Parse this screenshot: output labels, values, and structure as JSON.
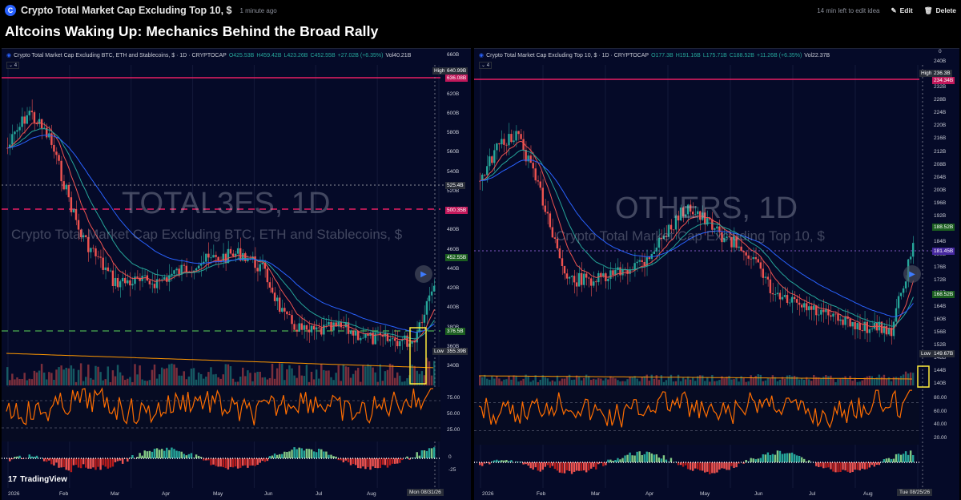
{
  "topbar": {
    "title": "Crypto Total Market Cap Excluding Top 10, $",
    "time_ago": "1 minute ago",
    "edit_note": "14 min left to edit idea",
    "edit_label": "Edit",
    "delete_label": "Delete"
  },
  "headline": "Altcoins Waking Up: Mechanics Behind the Broad Rally",
  "left": {
    "symbol": "Crypto Total Market Cap Excluding BTC, ETH and Stablecoins, $ · 1D · CRYPTOCAP",
    "ohlc": [
      "O425.53B",
      "H459.42B",
      "L423.26B",
      "C452.55B",
      "+27.02B (+6.35%)",
      "Vol40.21B"
    ],
    "badge": "4",
    "watermark_big": "TOTAL3ES, 1D",
    "watermark_small": "Crypto Total Market Cap Excluding BTC, ETH and Stablecoins, $",
    "price_ticks": [
      "660B",
      "640B",
      "620B",
      "600B",
      "580B",
      "560B",
      "540B",
      "520B",
      "500B",
      "480B",
      "460B",
      "440B",
      "420B",
      "400B",
      "380B",
      "360B",
      "340B"
    ],
    "tags": {
      "high_label": "High",
      "high_value": "640.99B",
      "red1": "636.08B",
      "gray1": "525.4B",
      "red2": "500.35B",
      "green1": "452.55B",
      "green2": "376.5B",
      "low_label": "Low",
      "low_value": "355.39B"
    },
    "rsi_ticks": [
      "75.00",
      "50.00",
      "25.00"
    ],
    "macd_ticks": [
      "0",
      "-25"
    ],
    "months": [
      "2026",
      "Feb",
      "Mar",
      "Apr",
      "May",
      "Jun",
      "Jul",
      "Aug"
    ],
    "date_tag": "Mon 08/31/26"
  },
  "right": {
    "symbol": "Crypto Total Market Cap Excluding Top 10, $ · 1D · CRYPTOCAP",
    "ohlc": [
      "O177.3B",
      "H191.16B",
      "L175.71B",
      "C188.52B",
      "+11.26B (+6.35%)",
      "Vol22.37B"
    ],
    "badge": "4",
    "watermark_big": "OTHERS, 1D",
    "watermark_small": "Crypto Total Market Cap Excluding Top 10, $",
    "price_ticks": [
      "240B",
      "236B",
      "232B",
      "228B",
      "224B",
      "220B",
      "216B",
      "212B",
      "208B",
      "204B",
      "200B",
      "196B",
      "192B",
      "188B",
      "184B",
      "180B",
      "176B",
      "172B",
      "168B",
      "164B",
      "160B",
      "156B",
      "152B",
      "148B",
      "144B",
      "140B"
    ],
    "tags": {
      "high_label": "High",
      "high_value": "236.3B",
      "red1": "234.34B",
      "green1": "188.52B",
      "purple1": "181.45B",
      "green2": "168.52B",
      "low_label": "Low",
      "low_value": "149.67B"
    },
    "rsi_ticks": [
      "80.00",
      "60.00",
      "40.00",
      "20.00"
    ],
    "macd_ticks": [
      "0"
    ],
    "months": [
      "2026",
      "Feb",
      "Mar",
      "Apr",
      "May",
      "Jun",
      "Jul",
      "Aug"
    ],
    "date_tag": "Tue 08/25/26"
  },
  "tv_logo": "TradingView",
  "colors": {
    "up": "#26a69a",
    "down": "#ef5350",
    "rsi": "#ff6d00",
    "ema_fast": "#ef5350",
    "ema_mid": "#26a69a",
    "ema_slow": "#2962ff",
    "highline": "#e91e63",
    "box": "#ffeb3b"
  }
}
